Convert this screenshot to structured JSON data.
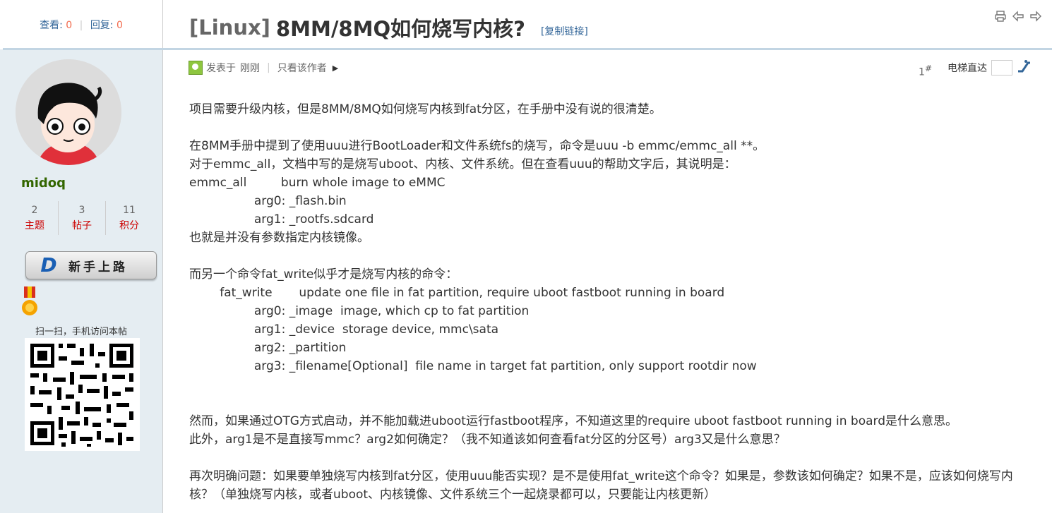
{
  "thread": {
    "views_label": "查看:",
    "views": "0",
    "replies_label": "回复:",
    "replies": "0",
    "prefix": "[Linux]",
    "title": "8MM/8MQ如何烧写内核?",
    "copy_link": "[复制链接]"
  },
  "top_icons": [
    "print-icon",
    "prev-thread-icon",
    "next-thread-icon"
  ],
  "author": {
    "name": "midoq",
    "stats": [
      {
        "value": "2",
        "label": "主题"
      },
      {
        "value": "3",
        "label": "帖子"
      },
      {
        "value": "11",
        "label": "积分"
      }
    ],
    "badge": "新手上路",
    "scan_text": "扫一扫，手机访问本帖"
  },
  "post": {
    "posted_label": "发表于",
    "posted_time": "刚刚",
    "only_author": "只看该作者",
    "floor": "1",
    "floor_suffix": "#",
    "elevator_label": "电梯直达",
    "lines": [
      "项目需要升级内核，但是8MM/8MQ如何烧写内核到fat分区，在手册中没有说的很清楚。",
      "",
      "在8MM手册中提到了使用uuu进行BootLoader和文件系统fs的烧写，命令是uuu -b emmc/emmc_all **。",
      "对于emmc_all，文档中写的是烧写uboot、内核、文件系统。但在查看uuu的帮助文字后，其说明是：",
      "emmc_all         burn whole image to eMMC",
      "                 arg0: _flash.bin",
      "                 arg1: _rootfs.sdcard",
      "也就是并没有参数指定内核镜像。",
      "",
      "而另一个命令fat_write似乎才是烧写内核的命令：",
      "        fat_write       update one file in fat partition, require uboot fastboot running in board",
      "                 arg0: _image  image, which cp to fat partition",
      "                 arg1: _device  storage device, mmc\\sata",
      "                 arg2: _partition",
      "                 arg3: _filename[Optional]  file name in target fat partition, only support rootdir now",
      "",
      "",
      "然而，如果通过OTG方式启动，并不能加载进uboot运行fastboot程序，不知道这里的require uboot fastboot running in board是什么意思。",
      "此外，arg1是不是直接写mmc？arg2如何确定？（我不知道该如何查看fat分区的分区号）arg3又是什么意思？",
      "",
      "再次明确问题：如果要单独烧写内核到fat分区，使用uuu能否实现？是不是使用fat_write这个命令？如果是，参数该如何确定？如果不是，应该如何烧写内核？（单独烧写内核，或者uboot、内核镜像、文件系统三个一起烧录都可以，只要能让内核更新）"
    ]
  },
  "colors": {
    "link": "#336699",
    "count": "#f26c4f",
    "username": "#336600",
    "stat_label": "#cc0000",
    "sidebar_bg": "#e5edf2",
    "rule": "#c2d5e3"
  }
}
